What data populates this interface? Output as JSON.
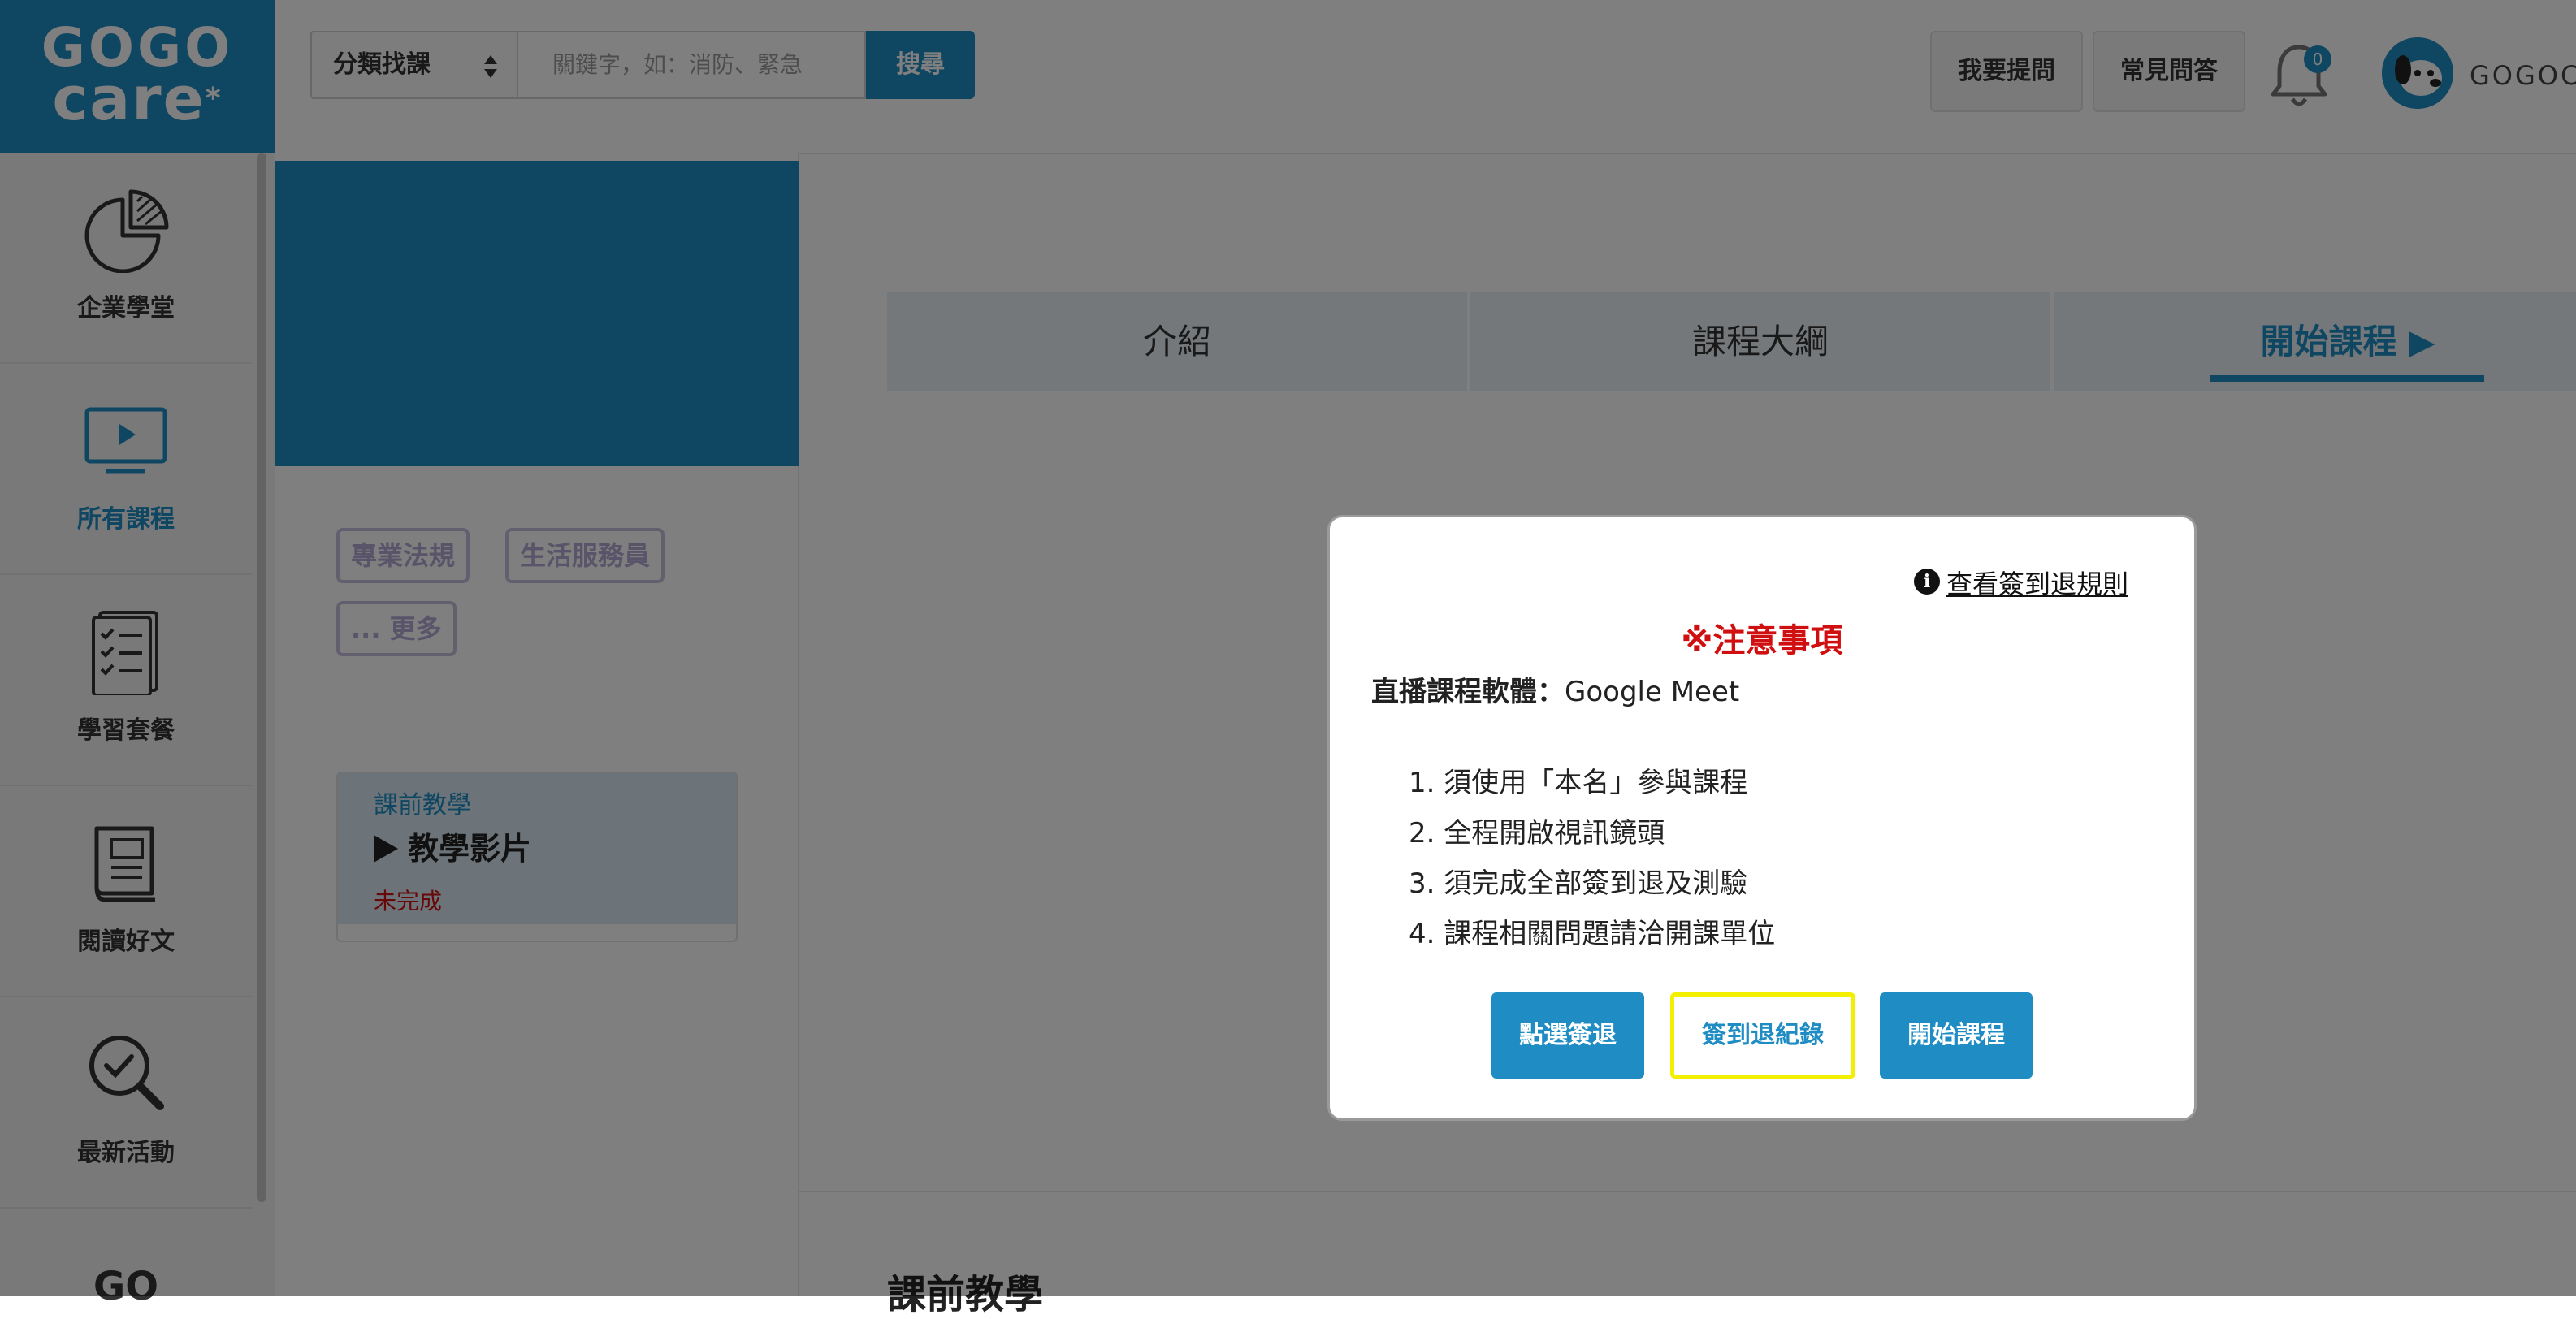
{
  "brand": {
    "line1": "GOGO",
    "line2": "care",
    "star": "*"
  },
  "header": {
    "category_select": "分類找課",
    "search_placeholder": "關鍵字，如：消防、緊急",
    "search_button": "搜尋",
    "ask_button": "我要提問",
    "faq_button": "常見問答",
    "notification_count": "0",
    "username": "GOGOCA"
  },
  "sidebar": {
    "items": [
      {
        "label": "企業學堂",
        "icon": "pie-chart-icon"
      },
      {
        "label": "所有課程",
        "icon": "video-monitor-icon",
        "active": true
      },
      {
        "label": "學習套餐",
        "icon": "checklist-icon"
      },
      {
        "label": "閱讀好文",
        "icon": "book-icon"
      },
      {
        "label": "最新活動",
        "icon": "magnifier-check-icon"
      }
    ],
    "more_label": "GO"
  },
  "course": {
    "tags": [
      "專業法規",
      "生活服務員"
    ],
    "more_tags": "... 更多",
    "lesson": {
      "category": "課前教學",
      "title": "教學影片",
      "status": "未完成"
    }
  },
  "tabs": [
    {
      "label": "介紹"
    },
    {
      "label": "課程大綱"
    },
    {
      "label": "開始課程 ▶",
      "active": true
    }
  ],
  "section_heading": "課前教學",
  "modal": {
    "rules_link": "查看簽到退規則",
    "notice_title": "※注意事項",
    "software_label": "直播課程軟體：",
    "software_value": "Google Meet",
    "rules": [
      "1. 須使用「本名」參與課程",
      "2. 全程開啟視訊鏡頭",
      "3. 須完成全部簽到退及測驗",
      "4. 課程相關問題請洽開課單位"
    ],
    "buttons": {
      "checkin": "點選簽退",
      "records": "簽到退紀錄",
      "start": "開始課程"
    }
  },
  "colors": {
    "brand_blue": "#1f8dc4",
    "alert_red": "#d01010",
    "highlight_yellow": "#f2f000"
  }
}
